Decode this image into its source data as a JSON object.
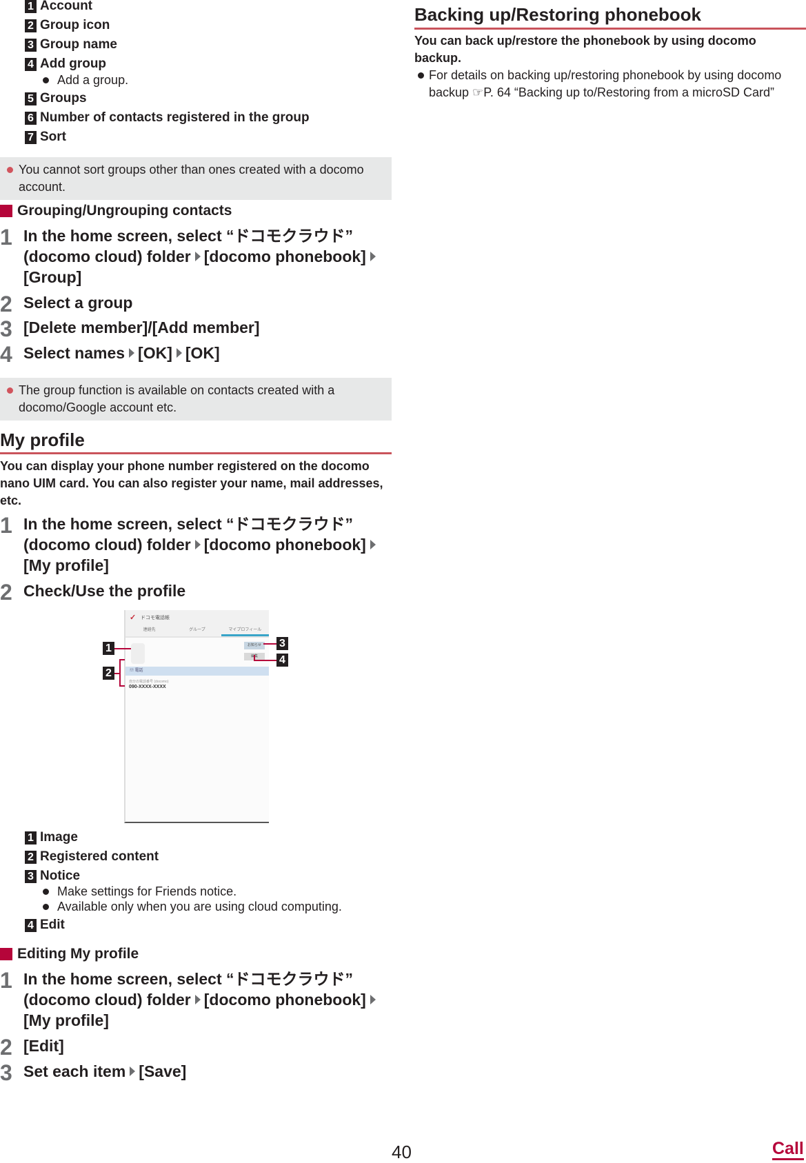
{
  "legend_top": [
    {
      "num": "1",
      "label": "Account"
    },
    {
      "num": "2",
      "label": "Group icon"
    },
    {
      "num": "3",
      "label": "Group name"
    },
    {
      "num": "4",
      "label": "Add group",
      "bullets": [
        "Add a group."
      ]
    },
    {
      "num": "5",
      "label": "Groups"
    },
    {
      "num": "6",
      "label": "Number of contacts registered in the group"
    },
    {
      "num": "7",
      "label": "Sort"
    }
  ],
  "note_sort": "You cannot sort groups other than ones created with a docomo account.",
  "grouping": {
    "heading": "Grouping/Ungrouping contacts",
    "steps": [
      {
        "num": "1",
        "parts": [
          "In the home screen, select “ドコモクラウド” (docomo cloud) folder",
          "[docomo phonebook]",
          "[Group]"
        ]
      },
      {
        "num": "2",
        "parts": [
          "Select a group"
        ]
      },
      {
        "num": "3",
        "parts": [
          "[Delete member]/[Add member]"
        ]
      },
      {
        "num": "4",
        "parts": [
          "Select names",
          "[OK]",
          "[OK]"
        ]
      }
    ],
    "note": "The group function is available on contacts created with a docomo/Google account etc."
  },
  "my_profile": {
    "title": "My profile",
    "lead": "You can display your phone number registered on the docomo nano UIM card. You can also register your name, mail addresses, etc.",
    "steps": [
      {
        "num": "1",
        "parts": [
          "In the home screen, select “ドコモクラウド” (docomo cloud) folder",
          "[docomo phonebook]",
          "[My profile]"
        ]
      },
      {
        "num": "2",
        "parts": [
          "Check/Use the profile"
        ]
      }
    ],
    "screenshot": {
      "app_title": "ドコモ電話帳",
      "tabs": [
        "連絡先",
        "グループ",
        "マイプロフィール"
      ],
      "notice_btn": "お知らせ",
      "edit_btn": "編集",
      "band_label": "電話",
      "number_caption": "自分の電話番号 (docomo)",
      "number": "090-XXXX-XXXX",
      "callouts": [
        "1",
        "2",
        "3",
        "4"
      ]
    },
    "legend": [
      {
        "num": "1",
        "label": "Image"
      },
      {
        "num": "2",
        "label": "Registered content"
      },
      {
        "num": "3",
        "label": "Notice",
        "bullets": [
          "Make settings for Friends notice.",
          "Available only when you are using cloud computing."
        ]
      },
      {
        "num": "4",
        "label": "Edit"
      }
    ]
  },
  "editing": {
    "heading": "Editing My profile",
    "steps": [
      {
        "num": "1",
        "parts": [
          "In the home screen, select “ドコモクラウド” (docomo cloud) folder",
          "[docomo phonebook]",
          "[My profile]"
        ]
      },
      {
        "num": "2",
        "parts": [
          "[Edit]"
        ]
      },
      {
        "num": "3",
        "parts": [
          "Set each item",
          "[Save]"
        ]
      }
    ]
  },
  "backup": {
    "title": "Backing up/Restoring phonebook",
    "lead": "You can back up/restore the phonebook by using docomo backup.",
    "bullet_pre": "For details on backing up/restoring phonebook by using docomo backup ",
    "ref_icon": "☞",
    "bullet_ref": "P. 64 “Backing up to/Restoring from a microSD Card”"
  },
  "footer": {
    "page_number": "40",
    "section_link": "Call"
  },
  "colors": {
    "accent": "#b5053a",
    "rule": "#c9535b",
    "note_bg": "#e7e8e8",
    "step_num": "#6d6e70"
  }
}
